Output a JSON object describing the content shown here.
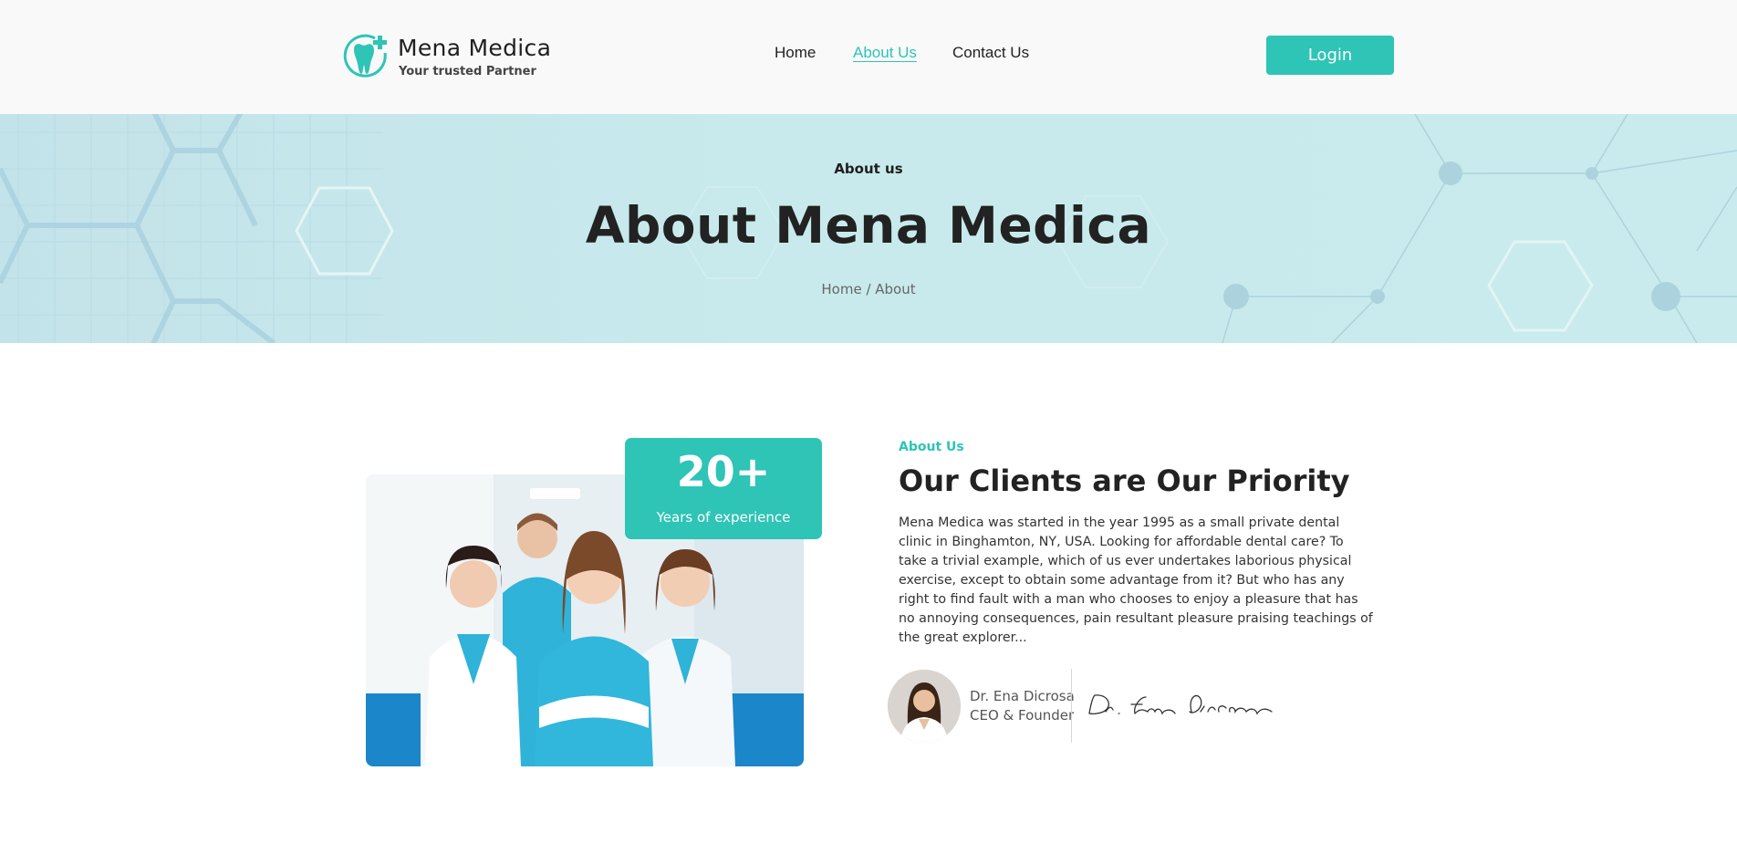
{
  "header": {
    "brand_name": "Mena Medica",
    "brand_tagline": "Your trusted Partner",
    "nav": [
      {
        "label": "Home",
        "active": false
      },
      {
        "label": "About Us",
        "active": true
      },
      {
        "label": "Contact Us",
        "active": false
      }
    ],
    "login_label": "Login"
  },
  "banner": {
    "kicker": "About us",
    "title": "About Mena Medica",
    "breadcrumb": {
      "home": "Home",
      "separator": " / ",
      "current": "About"
    }
  },
  "about": {
    "experience_value": "20+",
    "experience_label": "Years of experience",
    "kicker": "About Us",
    "heading": "Our Clients are Our Priority",
    "paragraph": "Mena Medica was started in the year 1995 as a small private dental clinic in Binghamton, NY, USA. Looking for affordable dental care? To take a trivial example, which of us ever undertakes laborious physical exercise, except to obtain some advantage from it? But who has any right to find fault with a man who chooses to enjoy a pleasure that has no annoying consequences, pain resultant pleasure praising teachings of the great explorer...",
    "founder_name": "Dr. Ena Dicrosa",
    "founder_role": "CEO & Founder",
    "signature_text": "Dr. Ena Dicrosa"
  },
  "colors": {
    "accent": "#2ec4b6",
    "banner_bg": "#c6e8ec",
    "header_bg": "#f9f9f9",
    "heading_text": "#222222"
  },
  "icons": {
    "logo": "tooth-plus-icon"
  }
}
